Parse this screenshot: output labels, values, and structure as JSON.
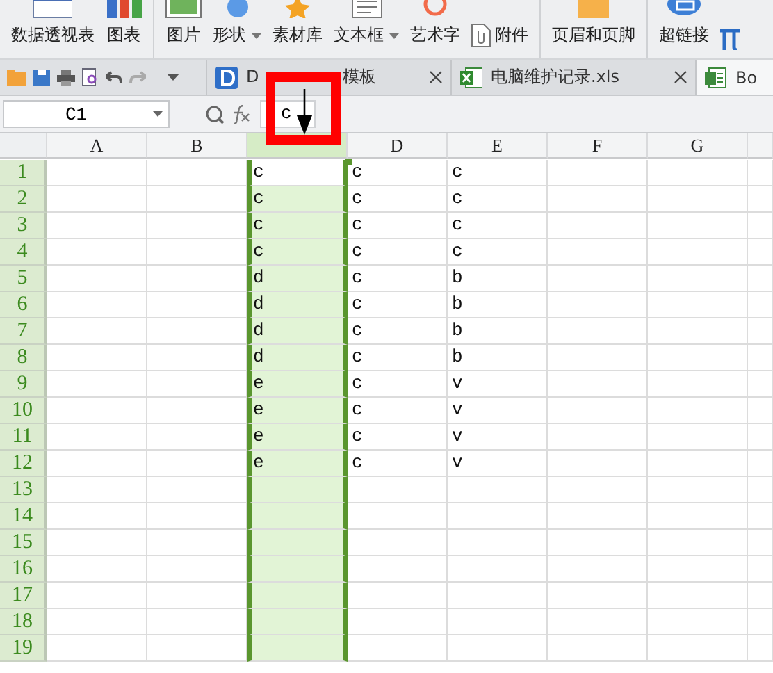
{
  "ribbon": {
    "groups": [
      [
        {
          "label": "数据透视表",
          "kind": "pivot",
          "dropdown": false
        },
        {
          "label": "图表",
          "kind": "chart",
          "dropdown": false
        }
      ],
      [
        {
          "label": "图片",
          "kind": "picture",
          "dropdown": false
        },
        {
          "label": "形状",
          "kind": "shape",
          "dropdown": true
        },
        {
          "label": "素材库",
          "kind": "library",
          "dropdown": false
        },
        {
          "label": "文本框",
          "kind": "textbox",
          "dropdown": true
        },
        {
          "label": "艺术字",
          "kind": "arttext",
          "dropdown": false
        },
        {
          "label": "附件",
          "kind": "attachment",
          "dropdown": false
        }
      ],
      [
        {
          "label": "页眉和页脚",
          "kind": "header",
          "dropdown": false
        }
      ],
      [
        {
          "label": "超链接",
          "kind": "link",
          "dropdown": false
        },
        {
          "kind": "formula"
        }
      ]
    ]
  },
  "tabs": [
    {
      "label_parts": [
        "D",
        "模板"
      ],
      "kind": "docer",
      "selected": false
    },
    {
      "label": "电脑维护记录.xls",
      "kind": "xls",
      "selected": false
    },
    {
      "label": "Bo",
      "kind": "doc",
      "selected": true
    }
  ],
  "formula_bar": {
    "name_box": "C1",
    "value": "c"
  },
  "sheet": {
    "columns": [
      {
        "label": "A",
        "selected": false
      },
      {
        "label": "B",
        "selected": false
      },
      {
        "selected": true
      },
      {
        "label": "D",
        "selected": false
      },
      {
        "label": "E",
        "selected": false
      },
      {
        "label": "F",
        "selected": false
      },
      {
        "label": "G",
        "selected": false
      }
    ],
    "rows": [
      {
        "number": "1",
        "active": true,
        "cells": {
          "C": "c",
          "D": "c",
          "E": "c"
        }
      },
      {
        "number": "2",
        "active": false,
        "cells": {
          "C": "c",
          "D": "c",
          "E": "c"
        }
      },
      {
        "number": "3",
        "active": false,
        "cells": {
          "C": "c",
          "D": "c",
          "E": "c"
        }
      },
      {
        "number": "4",
        "active": false,
        "cells": {
          "C": "c",
          "D": "c",
          "E": "c"
        }
      },
      {
        "number": "5",
        "active": false,
        "cells": {
          "C": "d",
          "D": "c",
          "E": "b"
        }
      },
      {
        "number": "6",
        "active": false,
        "cells": {
          "C": "d",
          "D": "c",
          "E": "b"
        }
      },
      {
        "number": "7",
        "active": false,
        "cells": {
          "C": "d",
          "D": "c",
          "E": "b"
        }
      },
      {
        "number": "8",
        "active": false,
        "cells": {
          "C": "d",
          "D": "c",
          "E": "b"
        }
      },
      {
        "number": "9",
        "active": false,
        "cells": {
          "C": "e",
          "D": "c",
          "E": "v"
        }
      },
      {
        "number": "10",
        "active": false,
        "cells": {
          "C": "e",
          "D": "c",
          "E": "v"
        }
      },
      {
        "number": "11",
        "active": false,
        "cells": {
          "C": "e",
          "D": "c",
          "E": "v"
        }
      },
      {
        "number": "12",
        "active": false,
        "cells": {
          "C": "e",
          "D": "c",
          "E": "v"
        }
      },
      {
        "number": "13",
        "active": false,
        "cells": {}
      },
      {
        "number": "14",
        "active": false,
        "cells": {}
      },
      {
        "number": "15",
        "active": false,
        "cells": {}
      },
      {
        "number": "16",
        "active": false,
        "cells": {}
      },
      {
        "number": "17",
        "active": false,
        "cells": {}
      },
      {
        "number": "18",
        "active": false,
        "cells": {}
      },
      {
        "number": "19",
        "active": false,
        "cells": {}
      }
    ]
  }
}
